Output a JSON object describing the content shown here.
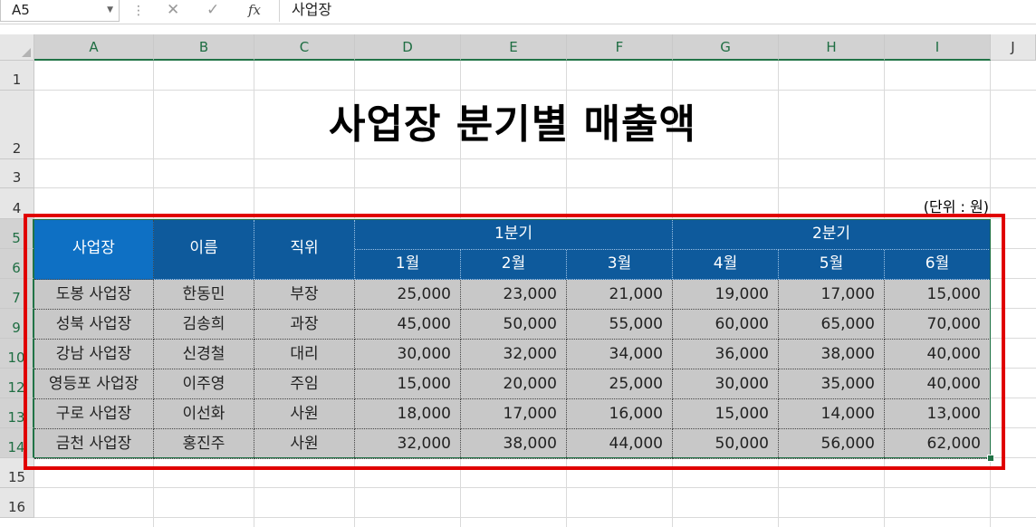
{
  "name_box": "A5",
  "formula_icons": {
    "cancel": "✕",
    "enter": "✓",
    "fx": "fx"
  },
  "formula_content": "사업장",
  "columns": [
    "A",
    "B",
    "C",
    "D",
    "E",
    "F",
    "G",
    "H",
    "I",
    "J"
  ],
  "rows": [
    "1",
    "2",
    "3",
    "4",
    "5",
    "6",
    "7",
    "9",
    "10",
    "12",
    "13",
    "14",
    "15",
    "16"
  ],
  "title": "사업장 분기별 매출액",
  "unit": "(단위 : 원)",
  "table": {
    "header_business": "사업장",
    "header_name": "이름",
    "header_position": "직위",
    "quarter1": "1분기",
    "quarter2": "2분기",
    "months": [
      "1월",
      "2월",
      "3월",
      "4월",
      "5월",
      "6월"
    ],
    "rows": [
      {
        "business": "도봉 사업장",
        "name": "한동민",
        "position": "부장",
        "values": [
          "25,000",
          "23,000",
          "21,000",
          "19,000",
          "17,000",
          "15,000"
        ]
      },
      {
        "business": "성북 사업장",
        "name": "김송희",
        "position": "과장",
        "values": [
          "45,000",
          "50,000",
          "55,000",
          "60,000",
          "65,000",
          "70,000"
        ]
      },
      {
        "business": "강남 사업장",
        "name": "신경철",
        "position": "대리",
        "values": [
          "30,000",
          "32,000",
          "34,000",
          "36,000",
          "38,000",
          "40,000"
        ]
      },
      {
        "business": "영등포 사업장",
        "name": "이주영",
        "position": "주임",
        "values": [
          "15,000",
          "20,000",
          "25,000",
          "30,000",
          "35,000",
          "40,000"
        ]
      },
      {
        "business": "구로 사업장",
        "name": "이선화",
        "position": "사원",
        "values": [
          "18,000",
          "17,000",
          "16,000",
          "15,000",
          "14,000",
          "13,000"
        ]
      },
      {
        "business": "금천 사업장",
        "name": "홍진주",
        "position": "사원",
        "values": [
          "32,000",
          "38,000",
          "44,000",
          "50,000",
          "56,000",
          "62,000"
        ]
      }
    ]
  },
  "colors": {
    "header_dark": "#0e5a9c",
    "header_bright": "#0e70c4",
    "body": "#c8c8c8",
    "selection": "#217346",
    "highlight": "#e00000"
  }
}
